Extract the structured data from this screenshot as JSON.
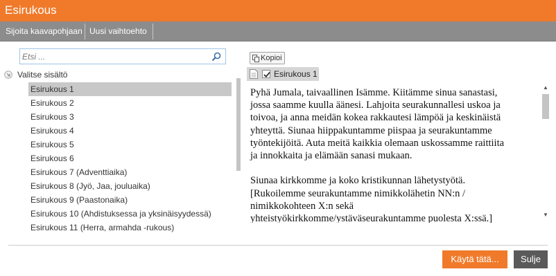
{
  "window": {
    "title": "Esirukous"
  },
  "toolbar": {
    "items": [
      {
        "label": "Sijoita kaavapohjaan"
      },
      {
        "label": "Uusi vaihtoehto"
      }
    ]
  },
  "search": {
    "placeholder": "Etsi ...",
    "value": ""
  },
  "tree": {
    "root_label": "Valitse sisältö",
    "items": [
      {
        "label": "Esirukous 1",
        "selected": true
      },
      {
        "label": "Esirukous 2"
      },
      {
        "label": "Esirukous 3"
      },
      {
        "label": "Esirukous 4"
      },
      {
        "label": "Esirukous 5"
      },
      {
        "label": "Esirukous 6"
      },
      {
        "label": "Esirukous 7 (Adventtiaika)"
      },
      {
        "label": "Esirukous 8 (Jyö, Jaa, jouluaika)"
      },
      {
        "label": "Esirukous 9 (Paastonaika)"
      },
      {
        "label": "Esirukous 10 (Ahdistuksessa ja yksinäisyydessä)"
      },
      {
        "label": "Esirukous 11 (Herra, armahda -rukous)"
      }
    ]
  },
  "preview": {
    "copy_label": "Kopioi",
    "doc_title": "Esirukous 1",
    "doc_checked": true,
    "lines": [
      "Pyhä Jumala, taivaallinen Isämme. Kiitämme sinua sanastasi,",
      "jossa saamme kuulla äänesi. Lahjoita seurakunnallesi uskoa ja",
      "toivoa, ja anna meidän kokea rakkautesi lämpöä ja keskinäistä",
      "yhteyttä. Siunaa hiippakuntamme piispaa ja seurakuntamme",
      "työntekijöitä. Auta meitä kaikkia olemaan uskossamme raittiita",
      "ja innokkaita ja elämään sanasi mukaan.",
      "",
      "Siunaa kirkkomme ja koko kristikunnan lähetystyötä.",
      "[Rukoilemme seurakuntamme nimikkolähetin NN:n /",
      "nimikkokohteen X:n sekä",
      "yhteistyökirkkomme/ystäväseurakuntamme puolesta X:ssä.]"
    ]
  },
  "footer": {
    "use_label": "Käytä tätä...",
    "close_label": "Sulje"
  },
  "colors": {
    "accent": "#f07a2a",
    "toolbar": "#8c8c8c",
    "selection": "#c8c8c8",
    "close_button": "#5a5a5a"
  }
}
